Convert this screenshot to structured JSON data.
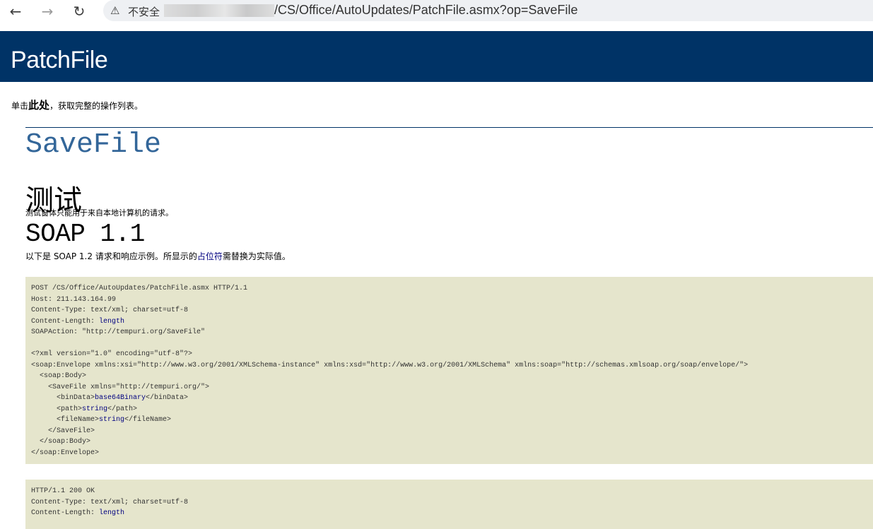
{
  "browser": {
    "back_icon": "←",
    "forward_icon": "→",
    "reload_icon": "↻",
    "warning_icon": "⚠",
    "insecure_label": "不安全",
    "url": "/CS/Office/AutoUpdates/PatchFile.asmx?op=SaveFile"
  },
  "page": {
    "heading": "PatchFile",
    "intro": {
      "prefix": "单击",
      "link": "此处",
      "suffix": "，获取完整的操作列表。"
    },
    "operation": "SaveFile",
    "test": {
      "heading": "测试",
      "note": "测试窗体只能用于来自本地计算机的请求。"
    },
    "soap": {
      "heading": "SOAP 1.1",
      "note_prefix": "以下是 SOAP 1.2 请求和响应示例。所显示的",
      "placeholder_label": "占位符",
      "note_suffix": "需替换为实际值。"
    },
    "request": {
      "line1": "POST /CS/Office/AutoUpdates/PatchFile.asmx HTTP/1.1",
      "line2": "Host: 211.143.164.99",
      "line3": "Content-Type: text/xml; charset=utf-8",
      "line4_key": "Content-Length: ",
      "line4_val": "length",
      "line5": "SOAPAction: \"http://tempuri.org/SaveFile\"",
      "line6": "",
      "line7": "<?xml version=\"1.0\" encoding=\"utf-8\"?>",
      "line8": "<soap:Envelope xmlns:xsi=\"http://www.w3.org/2001/XMLSchema-instance\" xmlns:xsd=\"http://www.w3.org/2001/XMLSchema\" xmlns:soap=\"http://schemas.xmlsoap.org/soap/envelope/\">",
      "line9": "  <soap:Body>",
      "line10": "    <SaveFile xmlns=\"http://tempuri.org/\">",
      "line11_open": "      <binData>",
      "line11_val": "base64Binary",
      "line11_close": "</binData>",
      "line12_open": "      <path>",
      "line12_val": "string",
      "line12_close": "</path>",
      "line13_open": "      <fileName>",
      "line13_val": "string",
      "line13_close": "</fileName>",
      "line14": "    </SaveFile>",
      "line15": "  </soap:Body>",
      "line16": "</soap:Envelope>"
    },
    "response": {
      "line1": "HTTP/1.1 200 OK",
      "line2": "Content-Type: text/xml; charset=utf-8",
      "line3_key": "Content-Length: ",
      "line3_val": "length"
    }
  }
}
